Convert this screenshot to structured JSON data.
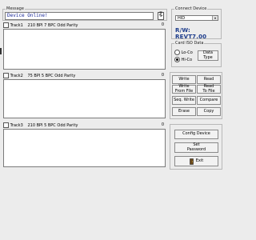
{
  "message": {
    "legend": "Message",
    "text": "Device Online!",
    "icon": "clipboard-battery-icon"
  },
  "tracks": [
    {
      "label": "Track1",
      "info": "210 BPI 7 BPC Odd Parity",
      "count": "0"
    },
    {
      "label": "Track2",
      "info": "75 BPI 5 BPC Odd Parity",
      "count": "0"
    },
    {
      "label": "Track3",
      "info": "210 BPI 5 BPC Odd Parity",
      "count": "0"
    }
  ],
  "connect": {
    "legend": "Connect Device",
    "selected": "HID",
    "version": "R/W: REVT7.00",
    "version_color": "#1a3a8a"
  },
  "card_iso": {
    "legend": "Card ISO Data",
    "lo_co": "Lo-Co",
    "hi_co": "Hi-Co",
    "selected": "hi_co",
    "data_type_label": "Data Type"
  },
  "actions": {
    "write": "Write",
    "read": "Read",
    "write_from_file": "Write\nFrom File",
    "read_to_file": "Read\nTo File",
    "seq_write": "Seq. Write",
    "compare": "Compare",
    "erase": "Erase",
    "copy": "Copy"
  },
  "bottom": {
    "config_device": "Config Device",
    "set_password": "Set\nPassword",
    "exit": "Exit",
    "exit_icon": "exit-door-icon"
  }
}
